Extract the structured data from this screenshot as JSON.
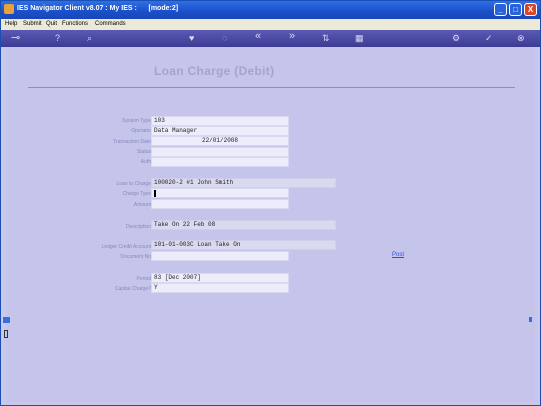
{
  "window": {
    "title": "IES Navigator Client v8.07 : My IES :      [mode:2]",
    "minimize": "_",
    "maximize": "□",
    "close": "X"
  },
  "menu": [
    "Help",
    "Submit",
    "Quit",
    "Functions",
    "Commands"
  ],
  "toolbar": {
    "key": "⊸",
    "help": "?",
    "search": "⌕",
    "favorite": "♥",
    "refresh": "◌",
    "back": "«",
    "forward": "»",
    "sort": "⇅",
    "grid": "▦",
    "settings": "⚙",
    "check": "✓",
    "close": "⊗"
  },
  "form": {
    "title": "Loan Charge (Debit)",
    "fields": [
      {
        "label": "System Type",
        "value": "103"
      },
      {
        "label": "Operator",
        "value": "Data Manager"
      },
      {
        "label": "Transaction Date",
        "value": "22/01/2008"
      },
      {
        "label": "Status",
        "value": ""
      },
      {
        "label": "Auth",
        "value": ""
      },
      {
        "label": "Loan to Charge",
        "value": "100020-2 #1 John Smith"
      },
      {
        "label": "Charge Type",
        "value": ""
      },
      {
        "label": "Amount",
        "value": ""
      },
      {
        "label": "Description",
        "value": "Take On 22 Feb 08"
      },
      {
        "label": "Ledger Credit Account",
        "value": "101-01-003C Loan Take On"
      },
      {
        "label": "Document No",
        "value": ""
      },
      {
        "label": "Period",
        "value": "83  [Dec 2007]"
      },
      {
        "label": "Capital Charge?",
        "value": "Y"
      }
    ],
    "post_link": "Post"
  },
  "colors": {
    "titlebar": "#1a4fc8",
    "toolbar": "#3c3c94",
    "background": "#c5c5ec",
    "link": "#3050d0"
  }
}
